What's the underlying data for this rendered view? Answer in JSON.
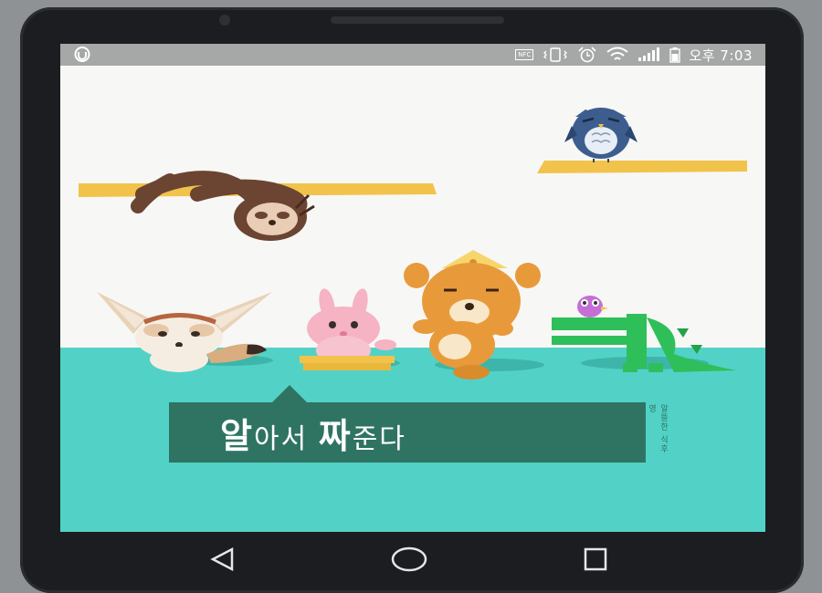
{
  "status_bar": {
    "left_icon": "u-plus-logo-icon",
    "nfc_label": "NFC",
    "icons": [
      "nfc-icon",
      "vibrate-icon",
      "alarm-icon",
      "wifi-icon",
      "signal-icon",
      "battery-icon"
    ],
    "time": "오후 7:03"
  },
  "splash": {
    "tagline_1": "알",
    "tagline_2": "아서 ",
    "tagline_3": "짜",
    "tagline_4": "준다",
    "side_text": "알뜰한 식후영",
    "colors": {
      "floor": "#52d2c6",
      "banner": "#2f7462",
      "shelf": "#f1c34a"
    },
    "characters": [
      "owl",
      "sloth",
      "fennec-fox",
      "rabbit",
      "bear",
      "crocodile",
      "bird"
    ]
  },
  "navigation": {
    "buttons": [
      "back-icon",
      "home-icon",
      "recents-icon"
    ]
  }
}
